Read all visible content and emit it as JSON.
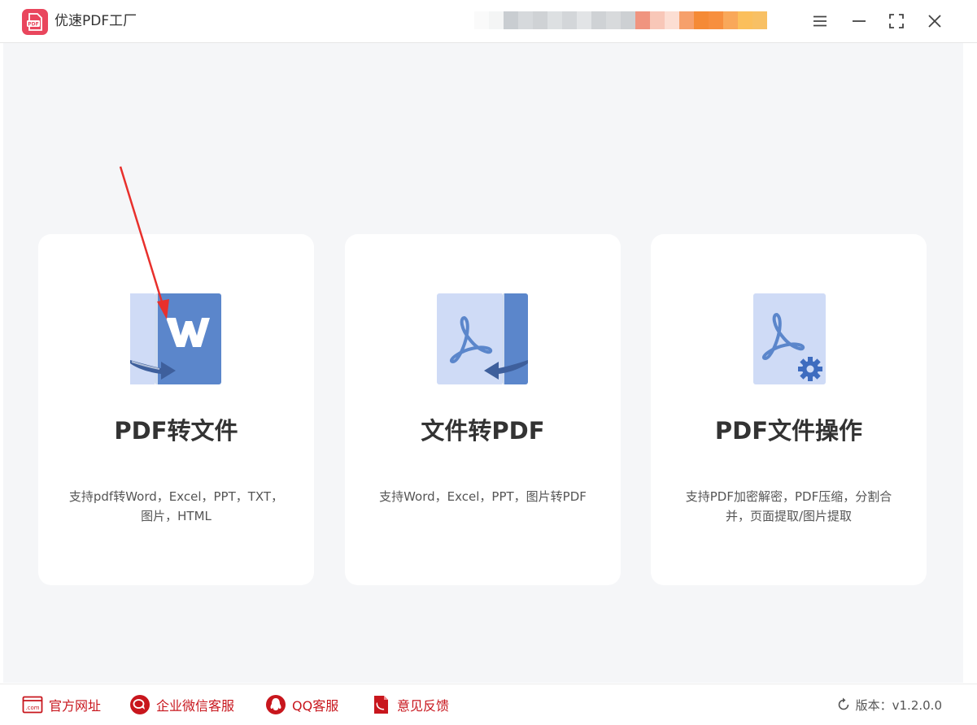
{
  "app": {
    "title": "优速PDF工厂",
    "logo_text": "PDF",
    "accent": "#e9465d"
  },
  "window_controls": {
    "icons": [
      "menu-icon",
      "minimize-icon",
      "maximize-icon",
      "close-icon"
    ]
  },
  "cards": [
    {
      "title": "PDF转文件",
      "desc_line1": "支持pdf转Word，Excel，PPT，TXT，",
      "desc_line2": "图片，HTML",
      "icon": "pdf-to-word-icon"
    },
    {
      "title": "文件转PDF",
      "desc_line1": "支持Word，Excel，PPT，图片转PDF",
      "desc_line2": "",
      "icon": "file-to-pdf-icon"
    },
    {
      "title": "PDF文件操作",
      "desc_line1": "支持PDF加密解密，PDF压缩，分割合",
      "desc_line2": "并，页面提取/图片提取",
      "icon": "pdf-settings-icon"
    }
  ],
  "footer": {
    "links": [
      {
        "label": "官方网址",
        "icon": "website-icon",
        "icon_text": ".com"
      },
      {
        "label": "企业微信客服",
        "icon": "wecom-icon"
      },
      {
        "label": "QQ客服",
        "icon": "qq-icon"
      },
      {
        "label": "意见反馈",
        "icon": "feedback-icon"
      }
    ],
    "version": "版本：v1.2.0.0",
    "link_color": "#c8161d"
  },
  "colors": {
    "icon_blue": "#5b86cb",
    "icon_light": "#cfdbf6",
    "annotation_red": "#e8302c"
  }
}
